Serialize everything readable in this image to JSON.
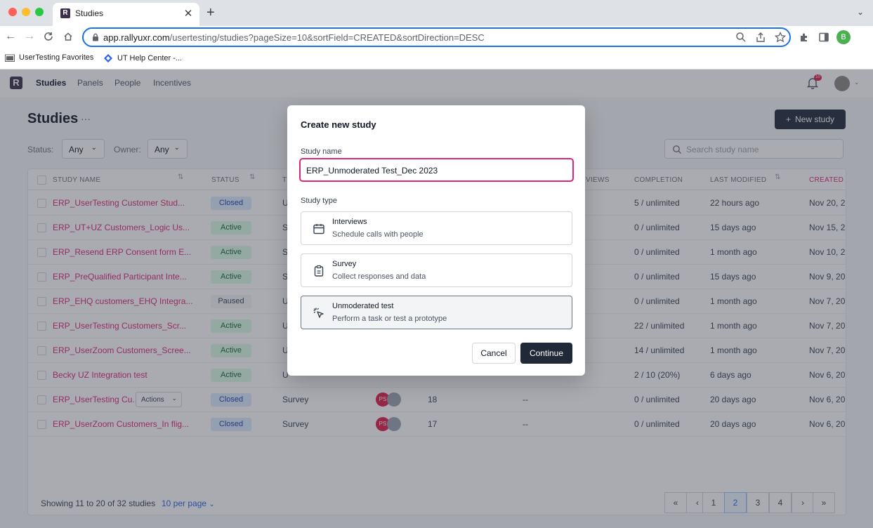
{
  "browser": {
    "tab_title": "Studies",
    "tab_favicon": "R",
    "url_host": "app.rallyuxr.com",
    "url_path": "/usertesting/studies?pageSize=10&sortField=CREATED&sortDirection=DESC",
    "profile_initial": "B",
    "bookmarks": [
      "UserTesting Favorites",
      "UT Help Center -..."
    ]
  },
  "app": {
    "logo": "R",
    "nav": [
      "Studies",
      "Panels",
      "People",
      "Incentives"
    ],
    "notifications_badge": "10",
    "page_title": "Studies",
    "title_more": "···",
    "new_study_label": "New study",
    "filters": {
      "status_label": "Status:",
      "status_value": "Any",
      "owner_label": "Owner:",
      "owner_value": "Any"
    },
    "search_placeholder": "Search study name",
    "table": {
      "headers": {
        "name": "STUDY NAME",
        "status": "STATUS",
        "type": "T",
        "views": "VIEWS",
        "completion": "COMPLETION",
        "last_modified": "LAST MODIFIED",
        "created": "CREATED"
      },
      "rows": [
        {
          "name": "ERP_UserTesting Customer Stud...",
          "status": "Closed",
          "type": "U",
          "completion": "5 / unlimited",
          "modified": "22 hours ago",
          "created": "Nov 20, 2("
        },
        {
          "name": "ERP_UT+UZ Customers_Logic Us...",
          "status": "Active",
          "type": "S",
          "completion": "0 / unlimited",
          "modified": "15 days ago",
          "created": "Nov 15, 2("
        },
        {
          "name": "ERP_Resend ERP Consent form E...",
          "status": "Active",
          "type": "S",
          "completion": "0 / unlimited",
          "modified": "1 month ago",
          "created": "Nov 10, 2("
        },
        {
          "name": "ERP_PreQualified Participant Inte...",
          "status": "Active",
          "type": "S",
          "completion": "0 / unlimited",
          "modified": "15 days ago",
          "created": "Nov 9, 202"
        },
        {
          "name": "ERP_EHQ customers_EHQ Integra...",
          "status": "Paused",
          "type": "U",
          "completion": "0 / unlimited",
          "modified": "1 month ago",
          "created": "Nov 7, 202"
        },
        {
          "name": "ERP_UserTesting Customers_Scr...",
          "status": "Active",
          "type": "U",
          "completion": "22 / unlimited",
          "modified": "1 month ago",
          "created": "Nov 7, 202"
        },
        {
          "name": "ERP_UserZoom Customers_Scree...",
          "status": "Active",
          "type": "U",
          "completion": "14 / unlimited",
          "modified": "1 month ago",
          "created": "Nov 7, 202"
        },
        {
          "name": "Becky UZ Integration test",
          "status": "Active",
          "type": "U",
          "completion": "2 / 10 (20%)",
          "modified": "6 days ago",
          "created": "Nov 6, 202"
        },
        {
          "name": "ERP_UserTesting Cu...",
          "actions": "Actions",
          "status": "Closed",
          "type": "Survey",
          "owners": "PS",
          "views": "18",
          "extra": "--",
          "completion": "0 / unlimited",
          "modified": "20 days ago",
          "created": "Nov 6, 202"
        },
        {
          "name": "ERP_UserZoom Customers_In flig...",
          "status": "Closed",
          "type": "Survey",
          "owners": "PS",
          "views": "17",
          "extra": "--",
          "completion": "0 / unlimited",
          "modified": "20 days ago",
          "created": "Nov 6, 202"
        }
      ]
    },
    "footer": {
      "showing_text": "Showing 11 to 20 of 32 studies",
      "per_page": "10 per page",
      "pages": [
        "«",
        "‹",
        "1",
        "2",
        "3",
        "4",
        "›",
        "»"
      ],
      "current_page": "2"
    }
  },
  "modal": {
    "title": "Create new study",
    "study_name_label": "Study name",
    "study_name_value": "ERP_Unmoderated Test_Dec 2023",
    "study_type_label": "Study type",
    "types": [
      {
        "name": "Interviews",
        "desc": "Schedule calls with people",
        "icon": "calendar-icon"
      },
      {
        "name": "Survey",
        "desc": "Collect responses and data",
        "icon": "clipboard-icon"
      },
      {
        "name": "Unmoderated test",
        "desc": "Perform a task or test a prototype",
        "icon": "cursor-click-icon"
      }
    ],
    "selected_type": "Unmoderated test",
    "cancel_label": "Cancel",
    "continue_label": "Continue"
  },
  "colors": {
    "accent_pink": "#db2777",
    "primary_dark": "#1f2937",
    "chrome_focus": "#1a73e8"
  }
}
